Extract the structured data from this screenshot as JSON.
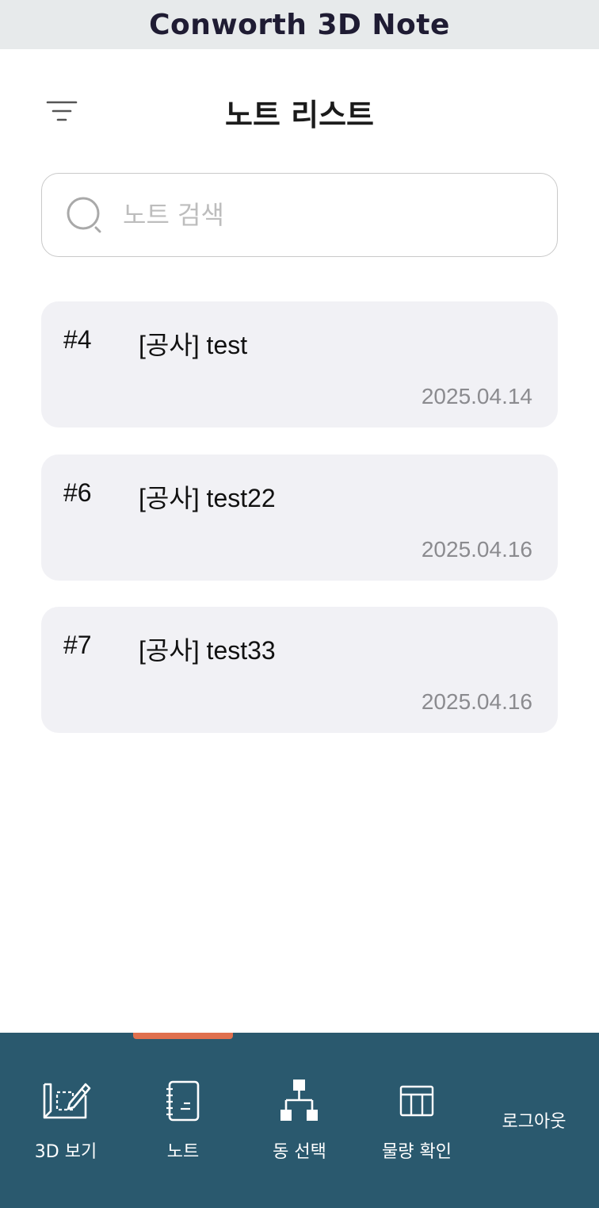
{
  "app": {
    "title": "Conworth 3D Note"
  },
  "header": {
    "title": "노트 리스트",
    "filter_icon": "filter-icon"
  },
  "search": {
    "placeholder": "노트 검색",
    "value": "",
    "icon": "search-icon"
  },
  "notes": [
    {
      "id": "#4",
      "title": "[공사] test",
      "date": "2025.04.14"
    },
    {
      "id": "#6",
      "title": "[공사] test22",
      "date": "2025.04.16"
    },
    {
      "id": "#7",
      "title": "[공사] test33",
      "date": "2025.04.16"
    }
  ],
  "nav": {
    "items": [
      {
        "label": "3D 보기",
        "icon": "blueprint-edit-icon"
      },
      {
        "label": "노트",
        "icon": "notebook-icon"
      },
      {
        "label": "동 선택",
        "icon": "hierarchy-icon"
      },
      {
        "label": "물량 확인",
        "icon": "table-icon"
      }
    ],
    "active_index": 1,
    "logout_label": "로그아웃"
  },
  "colors": {
    "titlebar_bg": "#e7eaeb",
    "nav_bg": "#2a596e",
    "accent": "#e0704e",
    "card_bg": "#f1f1f5",
    "date_text": "#8b8b8f"
  }
}
